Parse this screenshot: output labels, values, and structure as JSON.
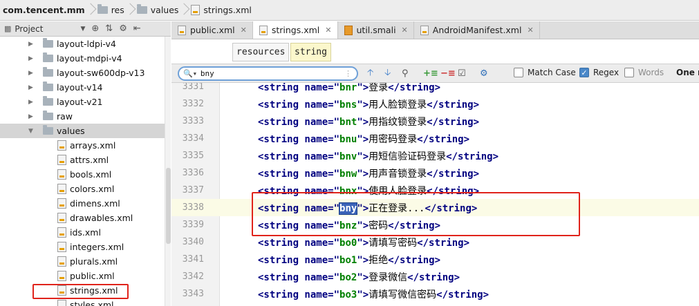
{
  "breadcrumb": {
    "items": [
      "com.tencent.mm",
      "res",
      "values",
      "strings.xml"
    ]
  },
  "project_panel": {
    "title": "Project",
    "tree": [
      {
        "label": "layout-ldpi-v4",
        "type": "folder",
        "expanded": false
      },
      {
        "label": "layout-mdpi-v4",
        "type": "folder",
        "expanded": false
      },
      {
        "label": "layout-sw600dp-v13",
        "type": "folder",
        "expanded": false
      },
      {
        "label": "layout-v14",
        "type": "folder",
        "expanded": false
      },
      {
        "label": "layout-v21",
        "type": "folder",
        "expanded": false
      },
      {
        "label": "raw",
        "type": "folder",
        "expanded": false
      },
      {
        "label": "values",
        "type": "folder",
        "expanded": true,
        "selected": true
      },
      {
        "label": "arrays.xml",
        "type": "file"
      },
      {
        "label": "attrs.xml",
        "type": "file"
      },
      {
        "label": "bools.xml",
        "type": "file"
      },
      {
        "label": "colors.xml",
        "type": "file"
      },
      {
        "label": "dimens.xml",
        "type": "file"
      },
      {
        "label": "drawables.xml",
        "type": "file"
      },
      {
        "label": "ids.xml",
        "type": "file"
      },
      {
        "label": "integers.xml",
        "type": "file"
      },
      {
        "label": "plurals.xml",
        "type": "file"
      },
      {
        "label": "public.xml",
        "type": "file"
      },
      {
        "label": "strings.xml",
        "type": "file",
        "highlighted": true
      },
      {
        "label": "styles.xml",
        "type": "file"
      }
    ]
  },
  "tabs": [
    {
      "label": "public.xml",
      "icon": "xml-file-icon",
      "active": false
    },
    {
      "label": "strings.xml",
      "icon": "xml-file-icon",
      "active": true
    },
    {
      "label": "util.smali",
      "icon": "smali-file-icon",
      "active": false
    },
    {
      "label": "AndroidManifest.xml",
      "icon": "xml-file-icon",
      "active": false
    }
  ],
  "structure_path": [
    "resources",
    "string"
  ],
  "search": {
    "query": "bny",
    "match_case_label": "Match Case",
    "match_case": false,
    "regex_label": "Regex",
    "regex": true,
    "words_label": "Words",
    "words": false,
    "more_label": "One m"
  },
  "editor": {
    "lines": [
      {
        "num": "3331",
        "name": "bnr",
        "text": "登录"
      },
      {
        "num": "3332",
        "name": "bns",
        "text": "用人脸锁登录"
      },
      {
        "num": "3333",
        "name": "bnt",
        "text": "用指纹锁登录"
      },
      {
        "num": "3334",
        "name": "bnu",
        "text": "用密码登录"
      },
      {
        "num": "3335",
        "name": "bnv",
        "text": "用短信验证码登录"
      },
      {
        "num": "3336",
        "name": "bnw",
        "text": "用声音锁登录"
      },
      {
        "num": "3337",
        "name": "bnx",
        "text": "使用人脸登录"
      },
      {
        "num": "3338",
        "name": "bny",
        "text": "正在登录...",
        "current": true,
        "match": true
      },
      {
        "num": "3339",
        "name": "bnz",
        "text": "密码"
      },
      {
        "num": "3340",
        "name": "bo0",
        "text": "请填写密码"
      },
      {
        "num": "3341",
        "name": "bo1",
        "text": "拒绝"
      },
      {
        "num": "3342",
        "name": "bo2",
        "text": "登录微信"
      },
      {
        "num": "3343",
        "name": "bo3",
        "text": "请填写微信密码"
      }
    ],
    "tag_open": "<string name=\"",
    "tag_mid": "\">",
    "tag_close": "</string>"
  },
  "colors": {
    "highlight_box": "#e0231b",
    "match_bg": "#3b63b8",
    "tag": "#000080",
    "value": "#008000"
  }
}
